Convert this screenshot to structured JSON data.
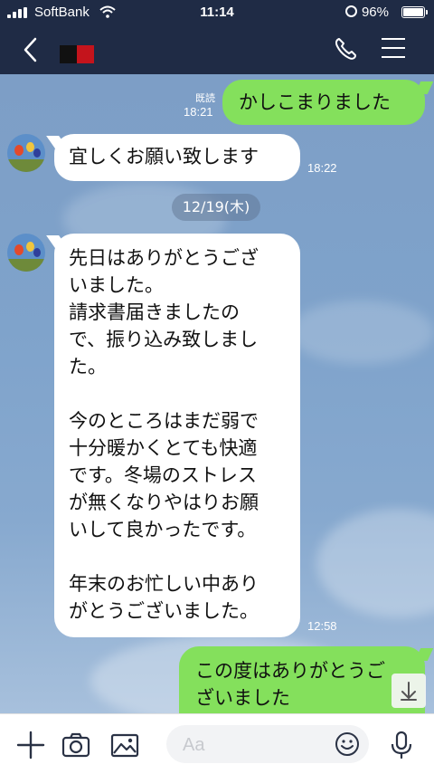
{
  "status_bar": {
    "carrier": "SoftBank",
    "time": "11:14",
    "battery": "96%"
  },
  "header": {
    "back_label": "back"
  },
  "messages": {
    "out1": {
      "text": "かしこまりました",
      "read": "既読",
      "time": "18:21"
    },
    "in1": {
      "text": "宜しくお願い致します",
      "time": "18:22"
    },
    "date": "12/19(木)",
    "in2": {
      "lines": [
        "先日はありがとうござ",
        "いました。",
        "請求書届きましたの",
        "で、振り込み致しまし",
        "た。",
        "",
        "今のところはまだ弱で",
        "十分暖かくとても快適",
        "です。冬場のストレス",
        "が無くなりやはりお願",
        "いして良かったです。",
        "",
        "年末のお忙しい中あり",
        "がとうございました。"
      ],
      "time": "12:58"
    },
    "out2": {
      "lines": [
        "この度はありがとうご",
        "ざいました"
      ]
    }
  },
  "input": {
    "placeholder": "Aa"
  },
  "colors": {
    "header_bg": "#1f2b45",
    "outgoing_bubble": "#84e05c",
    "incoming_bubble": "#ffffff",
    "chat_bg": "#7da0c8"
  }
}
